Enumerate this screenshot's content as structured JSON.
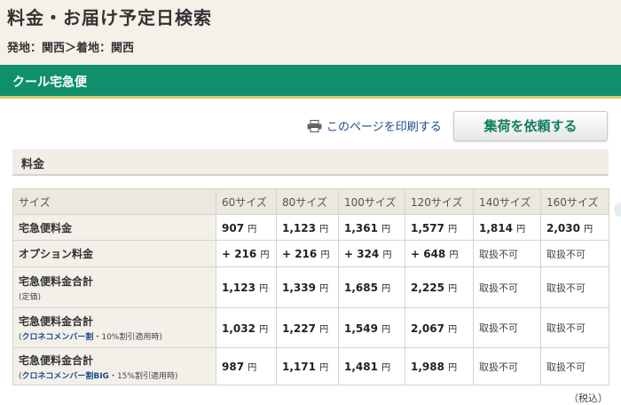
{
  "page": {
    "title": "料金・お届け予定日検索",
    "route": "発地：関西＞着地：関西"
  },
  "service": {
    "name": "クール宅急便"
  },
  "actions": {
    "print_label": "このページを印刷する",
    "request_label": "集荷を依頼する"
  },
  "section": {
    "title": "料金"
  },
  "table": {
    "corner_label": "サイズ",
    "unit": "円",
    "columns": [
      "60サイズ",
      "80サイズ",
      "100サイズ",
      "120サイズ",
      "140サイズ",
      "160サイズ"
    ],
    "rows": [
      {
        "label": "宅急便料金",
        "values": [
          "907",
          "1,123",
          "1,361",
          "1,577",
          "1,814",
          "2,030"
        ]
      },
      {
        "label": "オプション料金",
        "values": [
          "+ 216",
          "+ 216",
          "+ 324",
          "+ 648",
          "取扱不可",
          "取扱不可"
        ]
      },
      {
        "label": "宅急便料金合計",
        "sub_open": "(定価)",
        "values": [
          "1,123",
          "1,339",
          "1,685",
          "2,225",
          "取扱不可",
          "取扱不可"
        ]
      },
      {
        "label": "宅急便料金合計",
        "sub_open": "(",
        "sub_link": "クロネコメンバー割",
        "sub_rest": "・10%割引適用時)",
        "values": [
          "1,032",
          "1,227",
          "1,549",
          "2,067",
          "取扱不可",
          "取扱不可"
        ]
      },
      {
        "label": "宅急便料金合計",
        "sub_open": "(",
        "sub_link": "クロネコメンバー割BIG",
        "sub_rest": "・15%割引適用時)",
        "values": [
          "987",
          "1,171",
          "1,481",
          "1,988",
          "取扱不可",
          "取扱不可"
        ]
      }
    ]
  },
  "footer": {
    "tax_note": "（税込）"
  },
  "colors": {
    "brand_green": "#0f8f6c",
    "accent_gold": "#d9c86a",
    "link_blue": "#1a4b8c"
  },
  "icons": {
    "print": "printer-icon"
  }
}
